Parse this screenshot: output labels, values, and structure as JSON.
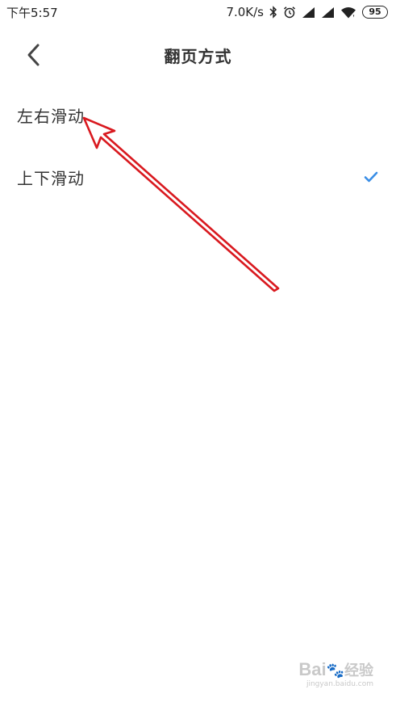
{
  "status_bar": {
    "time": "下午5:57",
    "network_speed": "7.0K/s",
    "battery_level": "95",
    "icons": [
      "bluetooth-icon",
      "alarm-icon",
      "signal-icon",
      "signal-icon",
      "wifi-icon",
      "battery-icon"
    ]
  },
  "header": {
    "title": "翻页方式",
    "back_icon": "chevron-left-icon"
  },
  "options": [
    {
      "label": "左右滑动",
      "selected": false
    },
    {
      "label": "上下滑动",
      "selected": true
    }
  ],
  "colors": {
    "check": "#3a8ee6",
    "annotation_arrow": "#d9191f",
    "text": "#333333"
  },
  "watermark": {
    "brand": "Bai",
    "suffix": "经验",
    "url": "jingyan.baidu.com"
  }
}
